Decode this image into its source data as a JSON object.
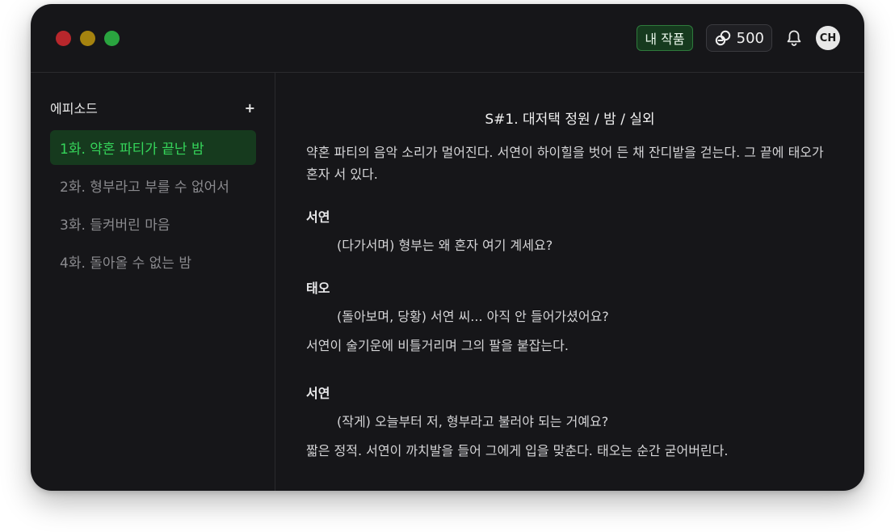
{
  "header": {
    "my_works_label": "내 작품",
    "credits": "500",
    "avatar_initials": "CH"
  },
  "sidebar": {
    "title": "에피소드",
    "add_label": "+",
    "episodes": [
      {
        "label": "1화. 약혼 파티가 끝난 밤"
      },
      {
        "label": "2화. 형부라고 부를 수 없어서"
      },
      {
        "label": "3화. 들켜버린 마음"
      },
      {
        "label": "4화. 돌아올 수 없는 밤"
      }
    ]
  },
  "scene": {
    "heading": "S#1. 대저택 정원 / 밤 / 실외",
    "action_1": "약혼 파티의 음악 소리가 멀어진다. 서연이 하이힐을 벗어 든 채 잔디밭을 걷는다. 그 끝에 태오가 혼자 서 있다.",
    "character_1": "서연",
    "dialogue_1": "(다가서며) 형부는 왜 혼자 여기 계세요?",
    "character_2": "태오",
    "dialogue_2": "(돌아보며, 당황) 서연 씨... 아직 안 들어가셨어요?",
    "action_2": "서연이 술기운에 비틀거리며 그의 팔을 붙잡는다.",
    "character_3": "서연",
    "dialogue_3": "(작게) 오늘부터 저, 형부라고 불러야 되는 거예요?",
    "action_3": "짧은 정적. 서연이 까치발을 들어 그에게 입을 맞춘다. 태오는 순간 굳어버린다."
  },
  "colors": {
    "window_bg": "#161619",
    "accent_green": "#35d45a",
    "active_bg": "#163a1e",
    "traffic_red": "#b8272c",
    "traffic_yellow": "#a5830f",
    "traffic_green": "#2aa43f"
  },
  "icons": {
    "credits": "link-coin-icon",
    "notifications": "bell-icon"
  }
}
